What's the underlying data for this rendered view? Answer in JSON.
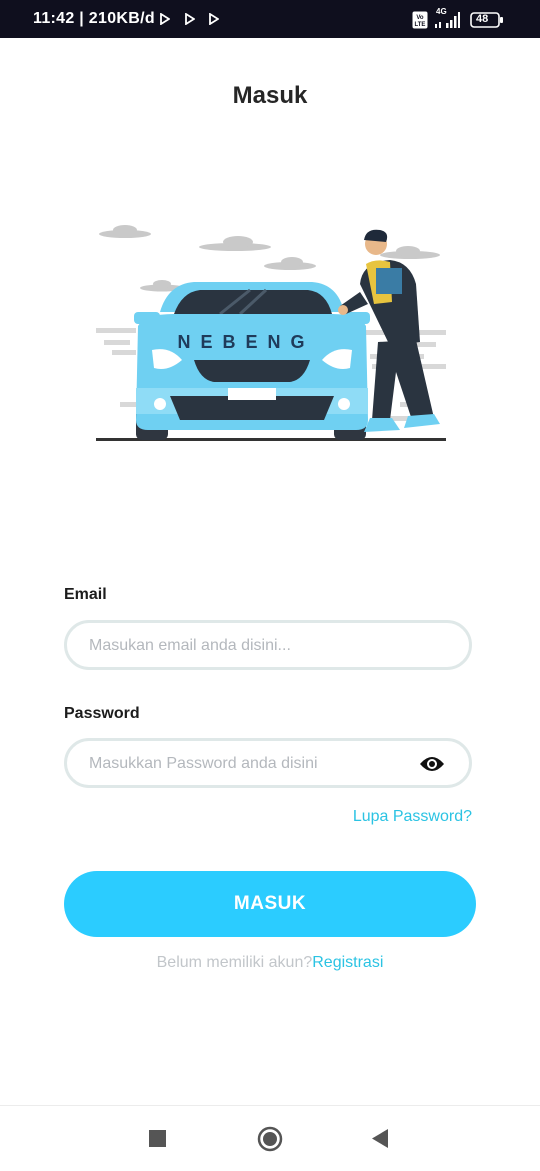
{
  "status_bar": {
    "time": "11:42 | 210KB/d",
    "network": "4G",
    "volte": "Vo LTE",
    "battery": "48"
  },
  "page": {
    "title": "Masuk"
  },
  "illustration": {
    "car_text": "NEBENG"
  },
  "form": {
    "email_label": "Email",
    "email_placeholder": "Masukan email anda disini...",
    "password_label": "Password",
    "password_placeholder": "Masukkan Password anda disini",
    "forgot_password": "Lupa Password?"
  },
  "login_button": "MASUK",
  "register": {
    "prompt": "Belum memiliki akun?",
    "link": "Registrasi"
  },
  "colors": {
    "accent": "#2bccff",
    "link": "#2bc3e3",
    "input_border": "#dfe8e8"
  },
  "icons": [
    "play-icon",
    "signal-icon",
    "battery-icon",
    "eye-icon",
    "nav-recent-icon",
    "nav-home-icon",
    "nav-back-icon"
  ]
}
